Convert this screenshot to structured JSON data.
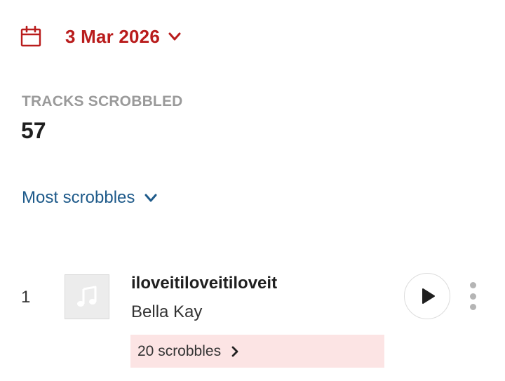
{
  "date_selector": {
    "label": "3 Mar 2026",
    "icon": "calendar-icon",
    "accent_color": "#b91c1c"
  },
  "stat": {
    "label": "TRACKS SCROBBLED",
    "value": "57"
  },
  "sort": {
    "label": "Most scrobbles",
    "color": "#1e5a8a"
  },
  "tracks": [
    {
      "rank": "1",
      "title": "iloveitiloveitiloveit",
      "artist": "Bella Kay",
      "scrobbles": "20 scrobbles",
      "artwork_icon": "music-note-icon"
    }
  ],
  "icons": {
    "play": "play-icon",
    "more": "more-vertical-icon",
    "chevron": "chevron-down-icon",
    "chevron_right": "chevron-right-icon"
  },
  "colors": {
    "pill_background": "#fce4e4",
    "label_grey": "#9a9a9a"
  }
}
